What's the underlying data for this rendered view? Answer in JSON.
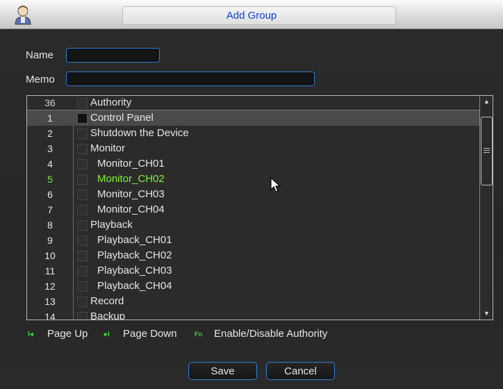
{
  "window": {
    "title": "Add Group"
  },
  "form": {
    "name_label": "Name",
    "name_value": "",
    "memo_label": "Memo",
    "memo_value": ""
  },
  "list": {
    "header": {
      "number": "36",
      "label": "Authority"
    },
    "rows": [
      {
        "number": "1",
        "label": "Control Panel",
        "checked": true,
        "selected": true,
        "indent": 0
      },
      {
        "number": "2",
        "label": "Shutdown the Device",
        "checked": false,
        "indent": 0
      },
      {
        "number": "3",
        "label": "Monitor",
        "checked": false,
        "indent": 0
      },
      {
        "number": "4",
        "label": "Monitor_CH01",
        "checked": false,
        "indent": 1
      },
      {
        "number": "5",
        "label": "Monitor_CH02",
        "checked": false,
        "highlighted": true,
        "indent": 1
      },
      {
        "number": "6",
        "label": "Monitor_CH03",
        "checked": false,
        "indent": 1
      },
      {
        "number": "7",
        "label": "Monitor_CH04",
        "checked": false,
        "indent": 1
      },
      {
        "number": "8",
        "label": "Playback",
        "checked": false,
        "indent": 0
      },
      {
        "number": "9",
        "label": "Playback_CH01",
        "checked": false,
        "indent": 1
      },
      {
        "number": "10",
        "label": "Playback_CH02",
        "checked": false,
        "indent": 1
      },
      {
        "number": "11",
        "label": "Playback_CH03",
        "checked": false,
        "indent": 1
      },
      {
        "number": "12",
        "label": "Playback_CH04",
        "checked": false,
        "indent": 1
      },
      {
        "number": "13",
        "label": "Record",
        "checked": false,
        "indent": 0
      },
      {
        "number": "14",
        "label": "Backup",
        "checked": false,
        "indent": 0
      }
    ]
  },
  "hints": {
    "page_up_icon": "I◂",
    "page_up": "Page Up",
    "page_down_icon": "▸I",
    "page_down": "Page Down",
    "fn_icon": "Fn",
    "enable_disable": "Enable/Disable Authority"
  },
  "buttons": {
    "save": "Save",
    "cancel": "Cancel"
  },
  "colors": {
    "accent": "#2f7fd8",
    "highlight": "#7ff23a",
    "title": "#1040c8"
  }
}
